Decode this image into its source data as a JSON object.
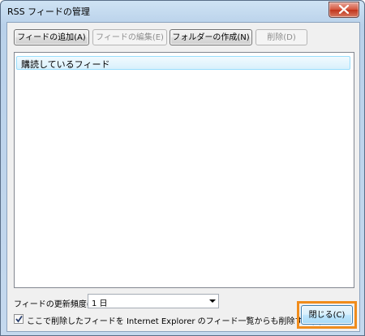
{
  "window": {
    "title": "RSS フィードの管理"
  },
  "toolbar": {
    "add_feed": "フィードの追加(A)",
    "edit_feed": "フィードの編集(E)",
    "create_folder": "フォルダーの作成(N)",
    "delete": "削除(D)"
  },
  "feed_tree": {
    "root_label": "購読しているフィード"
  },
  "update_frequency": {
    "label": "フィードの更新頻度(U):",
    "value": "1 日"
  },
  "delete_option": {
    "label": "ここで削除したフィードを Internet Explorer のフィード一覧からも削除する(F)",
    "checked": true
  },
  "footer": {
    "close": "閉じる(C)"
  },
  "colors": {
    "highlight": "#f08c1c",
    "selection": "#d8f0fc"
  }
}
